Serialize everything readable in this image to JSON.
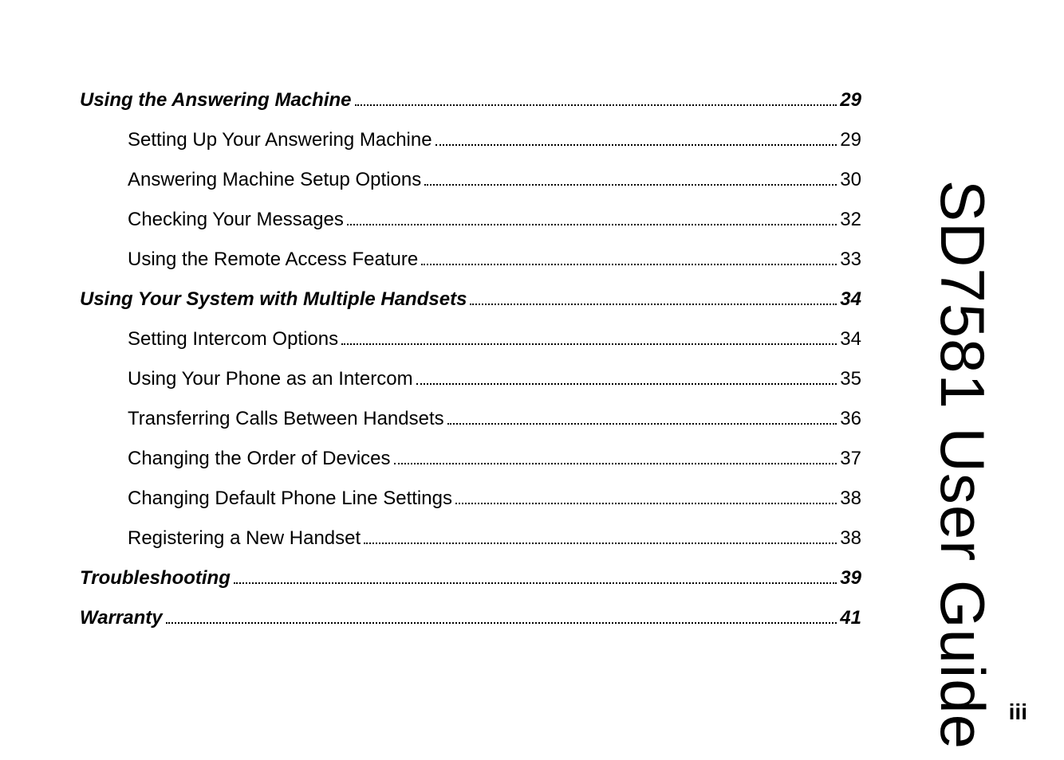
{
  "side_title": "SD7581 User Guide",
  "page_number": "iii",
  "toc": [
    {
      "type": "section",
      "label": "Using the Answering Machine",
      "page": "29"
    },
    {
      "type": "sub",
      "label": "Setting Up Your Answering Machine",
      "page": "29"
    },
    {
      "type": "sub",
      "label": "Answering Machine Setup Options",
      "page": "30"
    },
    {
      "type": "sub",
      "label": "Checking Your Messages",
      "page": "32"
    },
    {
      "type": "sub",
      "label": "Using the Remote Access Feature",
      "page": "33"
    },
    {
      "type": "section",
      "label": "Using Your System with Multiple Handsets",
      "page": "34"
    },
    {
      "type": "sub",
      "label": "Setting Intercom Options",
      "page": "34"
    },
    {
      "type": "sub",
      "label": "Using Your Phone as an Intercom",
      "page": "35"
    },
    {
      "type": "sub",
      "label": "Transferring Calls Between Handsets",
      "page": "36"
    },
    {
      "type": "sub",
      "label": "Changing the Order of Devices",
      "page": "37"
    },
    {
      "type": "sub",
      "label": "Changing Default Phone Line Settings",
      "page": "38"
    },
    {
      "type": "sub",
      "label": "Registering a New Handset",
      "page": "38"
    },
    {
      "type": "section",
      "label": "Troubleshooting",
      "page": "39"
    },
    {
      "type": "section",
      "label": "Warranty",
      "page": "41"
    }
  ]
}
